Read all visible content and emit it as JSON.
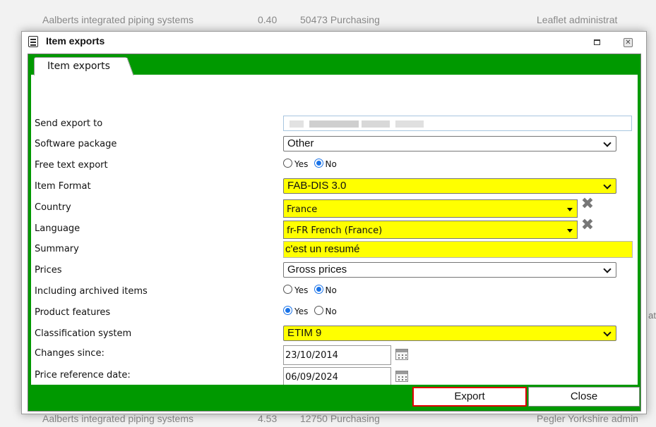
{
  "background": {
    "top_row": {
      "company": "Aalberts integrated piping systems",
      "col2": "0.40",
      "col3": "50473 Purchasing",
      "col4": "Leaflet administrat"
    },
    "bottom_row": {
      "company": "Aalberts integrated piping systems",
      "col2": "4.53",
      "col3": "12750 Purchasing",
      "col4": "Pegler Yorkshire admin"
    },
    "right_fragment": "at"
  },
  "dialog": {
    "title": "Item exports",
    "tab_label": "Item exports",
    "fields": {
      "send_export_to": {
        "label": "Send export to",
        "value": ""
      },
      "software_package": {
        "label": "Software package",
        "value": "Other"
      },
      "free_text_export": {
        "label": "Free text export",
        "yes": "Yes",
        "no": "No",
        "selected": "No"
      },
      "item_format": {
        "label": "Item Format",
        "value": "FAB-DIS 3.0"
      },
      "country": {
        "label": "Country",
        "value": "France"
      },
      "language": {
        "label": "Language",
        "value": "fr-FR French (France)"
      },
      "summary": {
        "label": "Summary",
        "value": "c'est un resumé"
      },
      "prices": {
        "label": "Prices",
        "value": "Gross prices"
      },
      "including_archived_items": {
        "label": "Including archived items",
        "yes": "Yes",
        "no": "No",
        "selected": "No"
      },
      "product_features": {
        "label": "Product features",
        "yes": "Yes",
        "no": "No",
        "selected": "Yes"
      },
      "classification_system": {
        "label": "Classification system",
        "value": "ETIM 9"
      },
      "changes_since": {
        "label": "Changes since:",
        "value": "23/10/2014"
      },
      "price_reference_date": {
        "label": "Price reference date:",
        "value": "06/09/2024"
      }
    },
    "buttons": {
      "export": "Export",
      "close": "Close"
    }
  },
  "colors": {
    "accent_green": "#009900",
    "highlight_yellow": "#ffff00",
    "radio_blue": "#1a73e8",
    "export_border": "#e00000"
  },
  "icons": [
    "list-icon",
    "maximize-icon",
    "close-icon",
    "clear-x-icon",
    "calendar-icon",
    "chevron-down-icon"
  ]
}
